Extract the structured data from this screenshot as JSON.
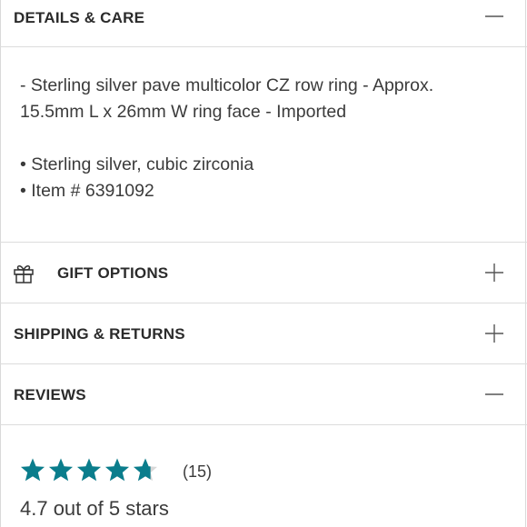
{
  "sections": {
    "details": {
      "title": "DETAILS & CARE",
      "toggle_icon": "minus-icon",
      "description_line1": "- Sterling silver pave multicolor CZ row ring - Approx.",
      "description_line2": "15.5mm L x 26mm W ring face - Imported",
      "bullet1": "• Sterling silver, cubic zirconia",
      "bullet2": "• Item # 6391092"
    },
    "gift": {
      "title": "GIFT OPTIONS",
      "icon": "gift-icon",
      "toggle_icon": "plus-icon"
    },
    "shipping": {
      "title": "SHIPPING & RETURNS",
      "toggle_icon": "plus-icon"
    },
    "reviews": {
      "title": "REVIEWS",
      "toggle_icon": "minus-icon",
      "rating": 4.7,
      "max_rating": 5,
      "count_label": "(15)",
      "rating_text": "4.7 out of 5 stars"
    }
  },
  "colors": {
    "star_fill": "#0a7d8c",
    "divider": "#dcdcdc",
    "text": "#2f2f2f"
  }
}
